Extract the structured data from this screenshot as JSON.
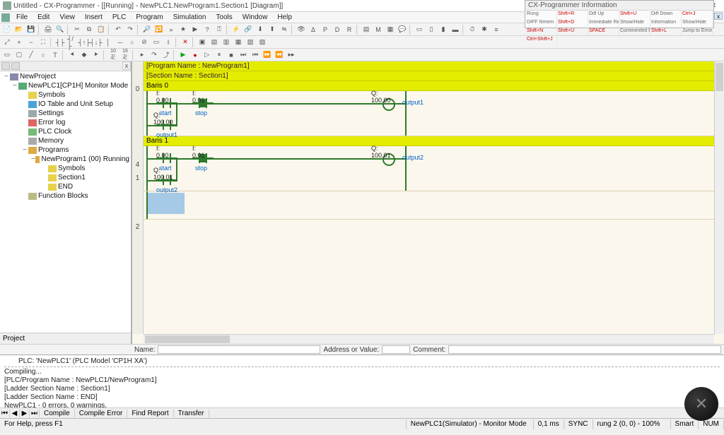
{
  "title": "Untitled - CX-Programmer - [[Running] - NewPLC1.NewProgram1.Section1 [Diagram]]",
  "info_panel": {
    "title": "CX-Programmer Information",
    "cells": [
      "Rung",
      "Shift+R",
      "Diff Up",
      "Shift+U",
      "Diff Down",
      "Ctrl+J",
      "DIFF Nmem",
      "Shift+D",
      "Immediate Ref",
      "Show/Hide",
      "Information",
      "Show/Hide",
      "Shift+N",
      "Shift+U",
      "SPACE",
      "Commented Rung",
      "Shift+L",
      "Jump to Error",
      "Ctrl+Shift+J"
    ]
  },
  "menu": [
    "File",
    "Edit",
    "View",
    "Insert",
    "PLC",
    "Program",
    "Simulation",
    "Tools",
    "Window",
    "Help"
  ],
  "tree": {
    "root": "NewProject",
    "plc": "NewPLC1[CP1H] Monitor Mode",
    "items": [
      "Symbols",
      "IO Table and Unit Setup",
      "Settings",
      "Error log",
      "PLC Clock",
      "Memory",
      "Programs"
    ],
    "program": "NewProgram1 (00) Running",
    "prog_children": [
      "Symbols",
      "Section1",
      "END"
    ],
    "fb": "Function Blocks",
    "tab": "Project"
  },
  "ladder": {
    "header1": "[Program Name : NewProgram1]",
    "header2": "[Section Name : Section1]",
    "rungs": [
      {
        "num": "0",
        "title": "Baris 0",
        "c1": {
          "addr": "I: 0.00",
          "name": "start"
        },
        "c2": {
          "addr": "I: 0.01",
          "name": "stop"
        },
        "branch": {
          "addr": "Q: 100.00",
          "name": "output1"
        },
        "coil": {
          "addr": "Q: 100.00",
          "name": "output1"
        }
      },
      {
        "num": "1",
        "title": "Baris 1",
        "c1": {
          "addr": "I: 0.00",
          "name": "start"
        },
        "c2": {
          "addr": "I: 0.01",
          "name": "stop"
        },
        "branch": {
          "addr": "Q: 100.01",
          "name": "output2"
        },
        "coil": {
          "addr": "Q: 100.01",
          "name": "output2"
        }
      }
    ],
    "endnum": "2",
    "gutter_mid": "4"
  },
  "fieldbar": {
    "name": "Name:",
    "addr": "Address or Value:",
    "comment": "Comment:"
  },
  "output": {
    "plc_line": "PLC: 'NewPLC1' (PLC Model 'CP1H XA')",
    "lines": [
      "Compiling...",
      "[PLC/Program Name : NewPLC1/NewProgram1]",
      "[Ladder Section Name : Section1]",
      "[Ladder Section Name : END]",
      "",
      "NewPLC1 - 0 errors, 0 warnings."
    ],
    "tabs": [
      "Compile",
      "Compile Error",
      "Find Report",
      "Transfer"
    ]
  },
  "status": {
    "help": "For Help, press F1",
    "plc": "NewPLC1(Simulator) - Monitor Mode",
    "time": "0,1 ms",
    "sync": "SYNC",
    "rung": "rung 2 (0, 0) - 100%",
    "smart": "Smart",
    "num": "NUM"
  }
}
